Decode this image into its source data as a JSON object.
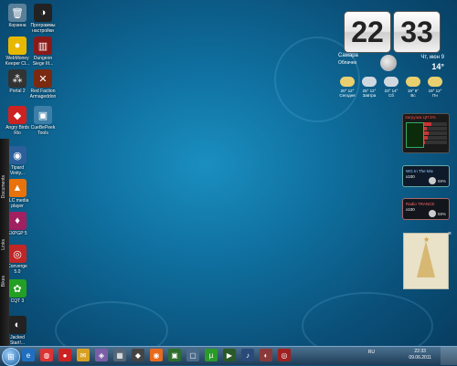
{
  "desktop": {
    "icons": [
      {
        "label": "Корзина",
        "glyph": "🗑",
        "color": "#5a7f99"
      },
      {
        "label": "Программы\nнастройки",
        "glyph": "◑",
        "color": "#222"
      },
      {
        "label": "WebMoney\nKeeper Cl...",
        "glyph": "●",
        "color": "#e8b800"
      },
      {
        "label": "Dungeon\nSiege III...",
        "glyph": "▥",
        "color": "#8a1a1a"
      },
      {
        "label": "Portal 2",
        "glyph": "⁂",
        "color": "#333"
      },
      {
        "label": "Red Faction\nArmageddon",
        "glyph": "✕",
        "color": "#7a2a10"
      },
      {
        "label": "Angry Birds\nRio",
        "glyph": "◆",
        "color": "#cc2222"
      },
      {
        "label": "CueBePeek\nTools",
        "glyph": "▣",
        "color": "#3d7fa8"
      },
      {
        "label": "Tipard\nVinity...",
        "glyph": "◉",
        "color": "#2a5f9a"
      },
      {
        "label": "VLC media\nplayer",
        "glyph": "▲",
        "color": "#e8720c"
      },
      {
        "label": "EXPGP 5",
        "glyph": "♦",
        "color": "#a02060"
      },
      {
        "label": "Converge\n5.0",
        "glyph": "◎",
        "color": "#c02626"
      },
      {
        "label": "CQT 3",
        "glyph": "✿",
        "color": "#23a023"
      },
      {
        "label": "Jacked\nStart!...",
        "glyph": "◐",
        "color": "#222"
      }
    ],
    "sidebar_labels": [
      "Documents",
      "Links",
      "Bikes"
    ]
  },
  "clock": {
    "hours": "22",
    "minutes": "33",
    "city": "Самара",
    "condition": "Облачно",
    "date": "Чт, июн 9",
    "temp": "14°"
  },
  "forecast": [
    {
      "temp": "20° 12°",
      "day": "Сегодня",
      "color": "#e8d070"
    },
    {
      "temp": "25° 12°",
      "day": "Завтра",
      "color": "#cfd8df"
    },
    {
      "temp": "23° 14°",
      "day": "Сб",
      "color": "#cfd8df"
    },
    {
      "temp": "19° 8°",
      "day": "Вс",
      "color": "#e8d070"
    },
    {
      "temp": "19° 12°",
      "day": "Пн",
      "color": "#e8d070"
    }
  ],
  "cpu": {
    "title": "Загрузка ЦП",
    "value": "5%",
    "rows": [
      0.3,
      0.1,
      0.2,
      0.15,
      0.05
    ]
  },
  "media1": {
    "title": "WG In The Mix",
    "subtitle": "x100",
    "volume": "59%"
  },
  "media2": {
    "title": "Radio TRANCE",
    "subtitle": "x100",
    "volume": "59%"
  },
  "taskbar": {
    "start": "⊞",
    "apps": [
      {
        "glyph": "e",
        "color": "#1f6fc0"
      },
      {
        "glyph": "◍",
        "color": "#d33"
      },
      {
        "glyph": "●",
        "color": "#cc2222"
      },
      {
        "glyph": "✉",
        "color": "#d8a020"
      },
      {
        "glyph": "◈",
        "color": "#7a5ea6"
      },
      {
        "glyph": "▦",
        "color": "#556677"
      },
      {
        "glyph": "◆",
        "color": "#444"
      },
      {
        "glyph": "◉",
        "color": "#e86a1a"
      },
      {
        "glyph": "▣",
        "color": "#2e6e2e"
      },
      {
        "glyph": "▢",
        "color": "#4a6a8a"
      },
      {
        "glyph": "µ",
        "color": "#2a9a2a"
      },
      {
        "glyph": "▶",
        "color": "#2a5a2a"
      },
      {
        "glyph": "♪",
        "color": "#2a4a7a"
      },
      {
        "glyph": "◐",
        "color": "#8a3a3a"
      },
      {
        "glyph": "◎",
        "color": "#a02020"
      }
    ],
    "lang": "RU",
    "time": "22:33",
    "date": "09.06.2011"
  }
}
